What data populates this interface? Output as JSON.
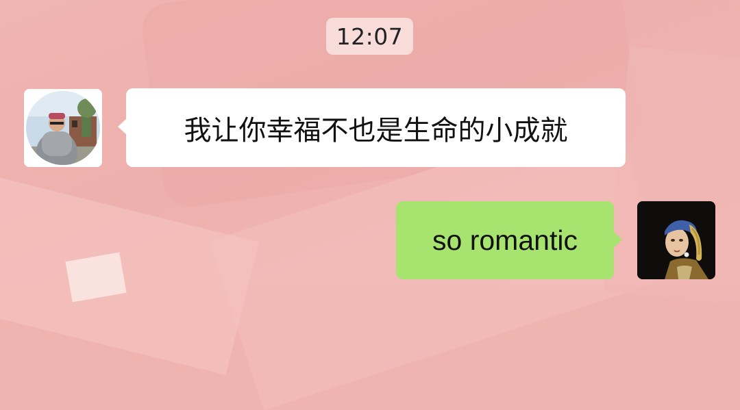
{
  "chat": {
    "timestamp": "12:07",
    "messages": [
      {
        "sender": "contact",
        "text": "我让你幸福不也是生命的小成就",
        "avatar": "person-photo-avatar"
      },
      {
        "sender": "self",
        "text": "so romantic",
        "avatar": "girl-with-pearl-earring-avatar"
      }
    ]
  },
  "colors": {
    "background": "#efb3b0",
    "incoming_bubble": "#ffffff",
    "outgoing_bubble": "#a6e46f",
    "timestamp_chip": "#f7dcda"
  }
}
